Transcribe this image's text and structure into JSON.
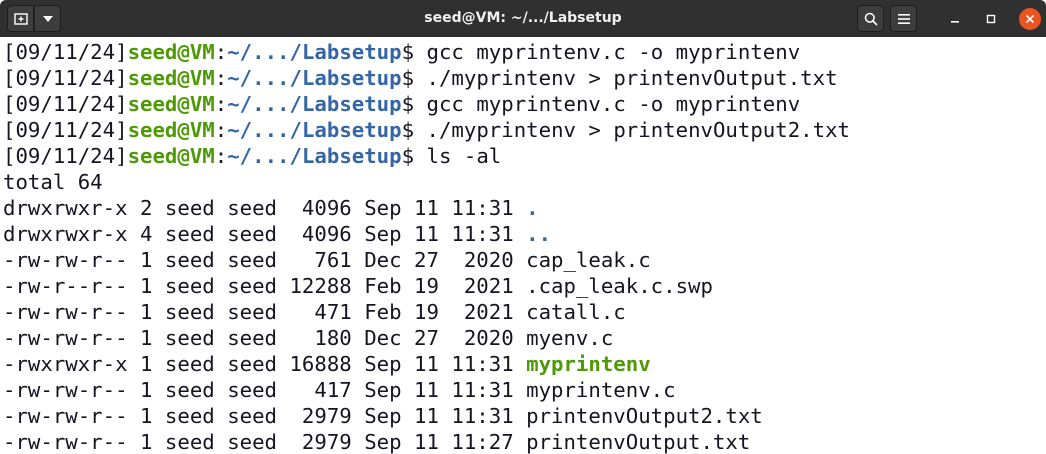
{
  "window": {
    "title": "seed@VM: ~/.../Labsetup",
    "icons": {
      "new_tab": "new-tab-icon",
      "menu": "chevron-down-icon",
      "search": "search-icon",
      "hamburger": "hamburger-menu-icon",
      "minimize": "minimize-icon",
      "maximize": "maximize-icon",
      "close": "close-icon"
    },
    "colors": {
      "titlebar": "#303030",
      "close_button": "#e95420",
      "prompt_user": "#4e9a06",
      "prompt_path": "#3465a4",
      "directory": "#3465a4",
      "executable": "#4e9a06"
    }
  },
  "terminal": {
    "prompts": [
      {
        "date": "[09/11/24]",
        "user": "seed@VM",
        "sep": ":",
        "path": "~/.../Labsetup",
        "dollar": "$ ",
        "command": "gcc myprintenv.c -o myprintenv"
      },
      {
        "date": "[09/11/24]",
        "user": "seed@VM",
        "sep": ":",
        "path": "~/.../Labsetup",
        "dollar": "$ ",
        "command": "./myprintenv > printenvOutput.txt"
      },
      {
        "date": "[09/11/24]",
        "user": "seed@VM",
        "sep": ":",
        "path": "~/.../Labsetup",
        "dollar": "$ ",
        "command": "gcc myprintenv.c -o myprintenv"
      },
      {
        "date": "[09/11/24]",
        "user": "seed@VM",
        "sep": ":",
        "path": "~/.../Labsetup",
        "dollar": "$ ",
        "command": "./myprintenv > printenvOutput2.txt"
      },
      {
        "date": "[09/11/24]",
        "user": "seed@VM",
        "sep": ":",
        "path": "~/.../Labsetup",
        "dollar": "$ ",
        "command": "ls -al"
      }
    ],
    "total": "total 64",
    "listing": [
      {
        "meta": "drwxrwxr-x 2 seed seed  4096 Sep 11 11:31 ",
        "name": ".",
        "kind": "dir"
      },
      {
        "meta": "drwxrwxr-x 4 seed seed  4096 Sep 11 11:31 ",
        "name": "..",
        "kind": "dir"
      },
      {
        "meta": "-rw-rw-r-- 1 seed seed   761 Dec 27  2020 ",
        "name": "cap_leak.c",
        "kind": "file"
      },
      {
        "meta": "-rw-r--r-- 1 seed seed 12288 Feb 19  2021 ",
        "name": ".cap_leak.c.swp",
        "kind": "file"
      },
      {
        "meta": "-rw-rw-r-- 1 seed seed   471 Feb 19  2021 ",
        "name": "catall.c",
        "kind": "file"
      },
      {
        "meta": "-rw-rw-r-- 1 seed seed   180 Dec 27  2020 ",
        "name": "myenv.c",
        "kind": "file"
      },
      {
        "meta": "-rwxrwxr-x 1 seed seed 16888 Sep 11 11:31 ",
        "name": "myprintenv",
        "kind": "exe"
      },
      {
        "meta": "-rw-rw-r-- 1 seed seed   417 Sep 11 11:31 ",
        "name": "myprintenv.c",
        "kind": "file"
      },
      {
        "meta": "-rw-rw-r-- 1 seed seed  2979 Sep 11 11:31 ",
        "name": "printenvOutput2.txt",
        "kind": "file"
      },
      {
        "meta": "-rw-rw-r-- 1 seed seed  2979 Sep 11 11:27 ",
        "name": "printenvOutput.txt",
        "kind": "file"
      }
    ]
  }
}
